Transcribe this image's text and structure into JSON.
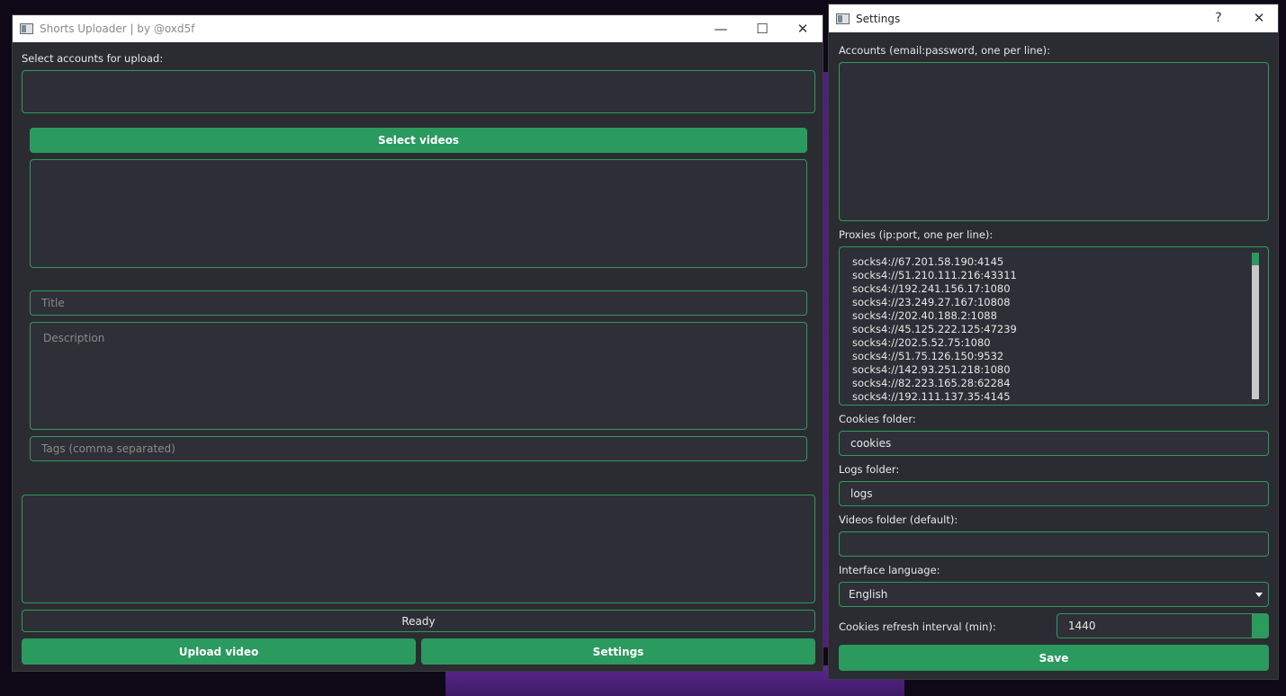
{
  "main_window": {
    "title": "Shorts Uploader | by @oxd5f",
    "controls": {
      "minimize": "—",
      "maximize": "☐",
      "close": "✕"
    },
    "accounts_label": "Select accounts for upload:",
    "select_videos_label": "Select videos",
    "title_placeholder": "Title",
    "description_placeholder": "Description",
    "tags_placeholder": "Tags (comma separated)",
    "status": "Ready",
    "upload_button": "Upload video",
    "settings_button": "Settings"
  },
  "settings_window": {
    "title": "Settings",
    "controls": {
      "help": "?",
      "close": "✕"
    },
    "accounts_label": "Accounts (email:password, one per line):",
    "proxies_label": "Proxies (ip:port, one per line):",
    "proxies": [
      "socks4://67.201.58.190:4145",
      "socks4://51.210.111.216:43311",
      "socks4://192.241.156.17:1080",
      "socks4://23.249.27.167:10808",
      "socks4://202.40.188.2:1088",
      "socks4://45.125.222.125:47239",
      "socks4://202.5.52.75:1080",
      "socks4://51.75.126.150:9532",
      "socks4://142.93.251.218:1080",
      "socks4://82.223.165.28:62284",
      "socks4://192.111.137.35:4145"
    ],
    "cookies_folder_label": "Cookies folder:",
    "cookies_folder_value": "cookies",
    "logs_folder_label": "Logs folder:",
    "logs_folder_value": "logs",
    "videos_folder_label": "Videos folder (default):",
    "videos_folder_value": "",
    "language_label": "Interface language:",
    "language_value": "English",
    "refresh_label": "Cookies refresh interval (min):",
    "refresh_value": "1440",
    "save_button": "Save"
  },
  "colors": {
    "accent": "#2a9a5e",
    "panel": "#2b2c32",
    "border": "#2f9a5a"
  }
}
